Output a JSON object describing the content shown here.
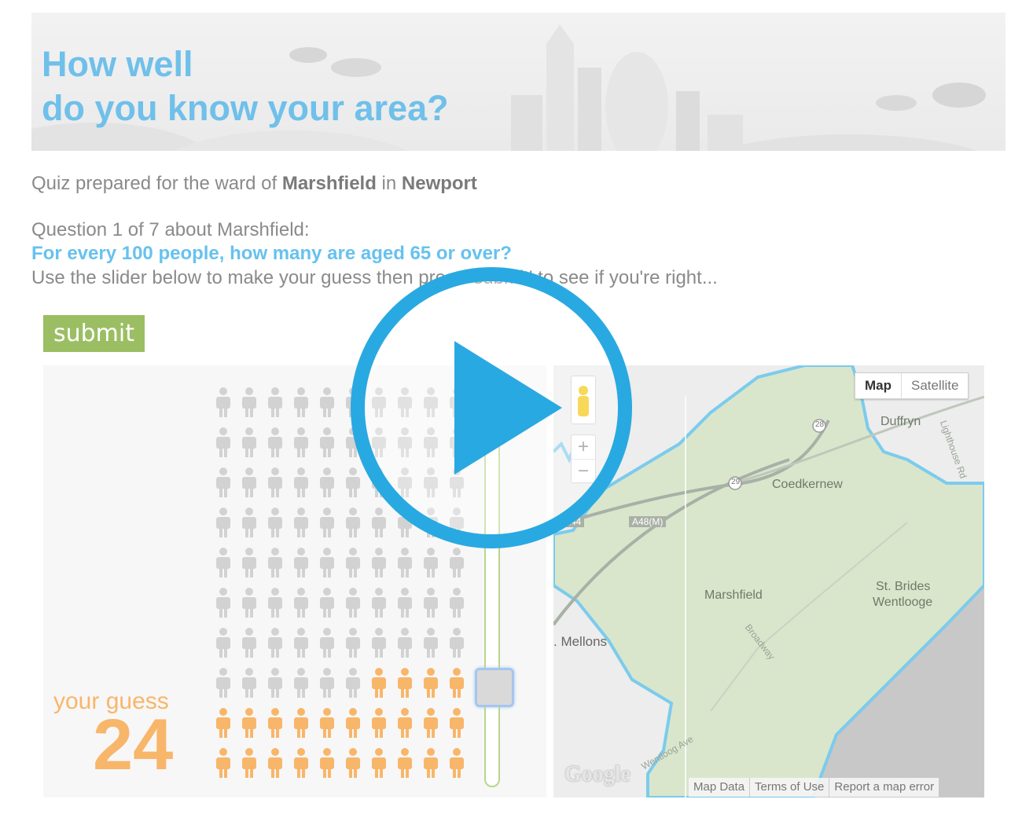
{
  "banner": {
    "title_line1": "How well",
    "title_line2": "do you know your area?"
  },
  "intro": {
    "prefix": "Quiz prepared for the ward of ",
    "ward": "Marshfield",
    "middle": " in ",
    "area": "Newport"
  },
  "question": {
    "count": "Question 1 of 7 about Marshfield:",
    "text": "For every 100 people, how many are aged 65 or over?",
    "hint": "Use the slider below to make your guess then press 'submit' to see if you're right..."
  },
  "submit_label": "submit",
  "guess": {
    "label": "your guess",
    "value": "24",
    "fraction": 0.24,
    "total_people": 100
  },
  "map": {
    "type_map": "Map",
    "type_satellite": "Satellite",
    "zoom_in": "+",
    "zoom_out": "−",
    "labels": {
      "duffryn": "Duffryn",
      "coedkernew": "Coedkernew",
      "marshfield": "Marshfield",
      "st_brides_1": "St. Brides",
      "st_brides_2": "Wentlooge",
      "mellons": ". Mellons",
      "a48m": "A48(M)",
      "a44": "A44",
      "broadway": "Broadway",
      "lighthouse": "Lighthouse Rd",
      "wentloog": "Wentloog Ave",
      "route_28": "28",
      "route_29": "29"
    },
    "footer": {
      "map_data": "Map Data",
      "terms": "Terms of Use",
      "report": "Report a map error"
    },
    "logo": "Google"
  },
  "colors": {
    "accent_blue": "#66c2ee",
    "guess_orange": "#f8b66a",
    "person_grey": "#d2d2d2",
    "submit_green": "#9bbe63",
    "ward_green": "#d9e6cc",
    "ward_border": "#7ccbed",
    "play_blue": "#29a9e1"
  }
}
